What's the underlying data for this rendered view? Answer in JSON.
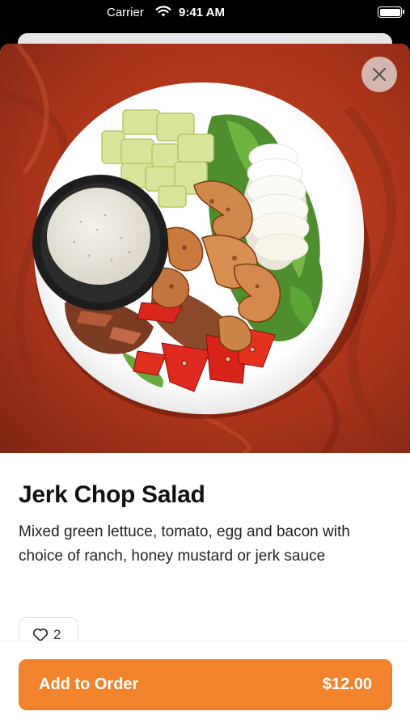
{
  "status_bar": {
    "carrier": "Carrier",
    "time": "9:41 AM"
  },
  "item": {
    "name": "Jerk Chop Salad",
    "description": "Mixed green lettuce, tomato, egg and bacon with choice of ranch, honey mustard or jerk sauce",
    "likes": "2"
  },
  "footer": {
    "add_label": "Add to Order",
    "price": "$12.00"
  },
  "colors": {
    "accent": "#f0832c",
    "table": "#a8331a"
  },
  "icons": {
    "close": "close-icon",
    "like": "heart-outline-icon",
    "wifi": "wifi-icon",
    "battery": "battery-icon"
  }
}
